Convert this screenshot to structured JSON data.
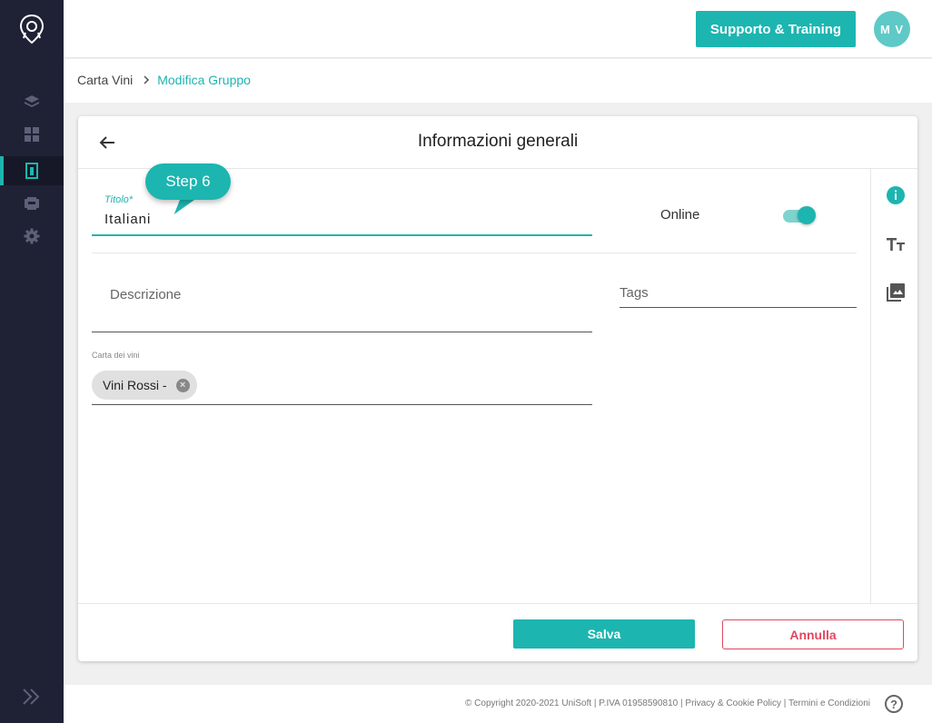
{
  "header": {
    "support_label": "Supporto & Training",
    "avatar_initials": "M V"
  },
  "breadcrumb": {
    "items": [
      "Carta Vini"
    ],
    "current": "Modifica Gruppo"
  },
  "card": {
    "title": "Informazioni generali"
  },
  "form": {
    "title_label": "Titolo*",
    "title_value": "Italiani",
    "online_label": "Online",
    "online_enabled": true,
    "description_placeholder": "Descrizione",
    "tags_placeholder": "Tags",
    "carta_label": "Carta dei vini",
    "carta_chips": [
      "Vini Rossi -"
    ]
  },
  "actions": {
    "save_label": "Salva",
    "cancel_label": "Annulla"
  },
  "callout": {
    "text": "Step 6"
  },
  "footer": {
    "copyright": "© Copyright 2020-2021 UniSoft | P.IVA 01958590810 | Privacy & Cookie Policy | Termini e Condizioni",
    "help_glyph": "?"
  },
  "colors": {
    "accent": "#1db5b0",
    "sidebar": "#1f2134",
    "danger": "#e04860"
  },
  "icons": {
    "sidebar": [
      "layers-icon",
      "dashboard-icon",
      "wine-menu-icon",
      "pdf-icon",
      "gear-icon"
    ],
    "rail": [
      "info-icon",
      "text-format-icon",
      "image-gallery-icon"
    ]
  }
}
